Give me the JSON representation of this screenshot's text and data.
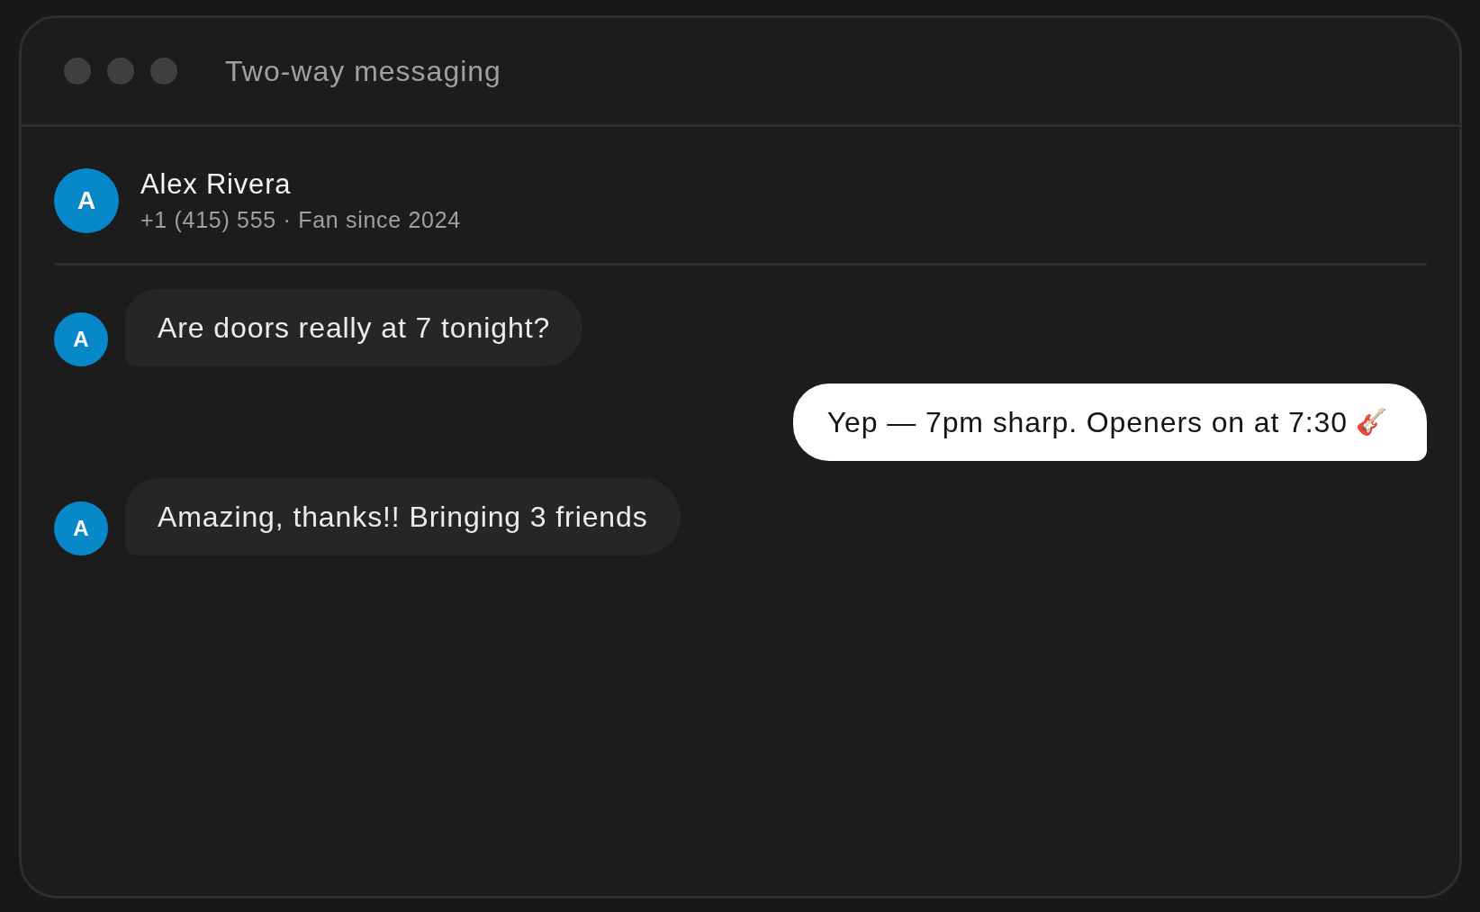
{
  "window": {
    "title": "Two-way messaging"
  },
  "contact": {
    "initial": "A",
    "name": "Alex Rivera",
    "subtitle": "+1 (415) 555 · Fan since 2024"
  },
  "messages": [
    {
      "kind": "incoming",
      "avatar": "A",
      "text": "Are doors really at 7 tonight?"
    },
    {
      "kind": "outgoing",
      "text": "Yep — 7pm sharp. Openers on at 7:30",
      "emoji": "🎸"
    },
    {
      "kind": "incoming",
      "avatar": "A",
      "text": "Amazing, thanks!! Bringing 3 friends"
    }
  ]
}
